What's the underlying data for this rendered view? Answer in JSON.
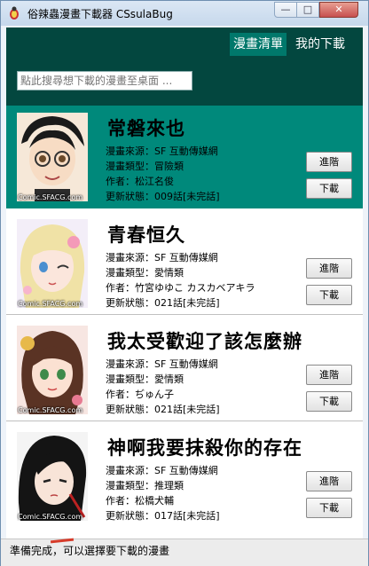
{
  "window": {
    "title": "俗辣蟲漫畫下載器 CSsulaBug",
    "min": "—",
    "max": "□",
    "close": "✕"
  },
  "tabs": [
    {
      "label": "漫畫清單"
    },
    {
      "label": "我的下載"
    }
  ],
  "search": {
    "placeholder": "點此搜尋想下載的漫畫至桌面 ..."
  },
  "items": [
    {
      "title": "常磐來也",
      "source": "漫畫來源：SF 互動傳媒網",
      "genre": "漫畫類型：冒險類",
      "author": "作者：松江名俊",
      "status": "更新狀態：009話[未完話]",
      "enter": "進階",
      "download": "下載",
      "watermark": "Comic.SFACG.com"
    },
    {
      "title": "青春恒久",
      "source": "漫畫來源：SF 互動傳媒網",
      "genre": "漫畫類型：愛情類",
      "author": "作者：竹宮ゆゆこ カスカベアキラ",
      "status": "更新狀態：021話[未完話]",
      "enter": "進階",
      "download": "下載",
      "watermark": "Comic.SFACG.com"
    },
    {
      "title": "我太受歡迎了該怎麼辦",
      "source": "漫畫來源：SF 互動傳媒網",
      "genre": "漫畫類型：愛情類",
      "author": "作者：ぢゅん子",
      "status": "更新狀態：021話[未完話]",
      "enter": "進階",
      "download": "下載",
      "watermark": "Comic.SFACG.com"
    },
    {
      "title": "神啊我要抹殺你的存在",
      "source": "漫畫來源：SF 互動傳媒網",
      "genre": "漫畫類型：推理類",
      "author": "作者：松橋犬輔",
      "status": "更新狀態：017話[未完話]",
      "enter": "進階",
      "download": "下載",
      "watermark": "Comic.SFACG.com"
    }
  ],
  "statusbar": {
    "text": "準備完成，可以選擇要下載的漫畫"
  },
  "colors": {
    "header": "#03473f",
    "selected": "#00897b",
    "tab_active": "#00786b"
  }
}
